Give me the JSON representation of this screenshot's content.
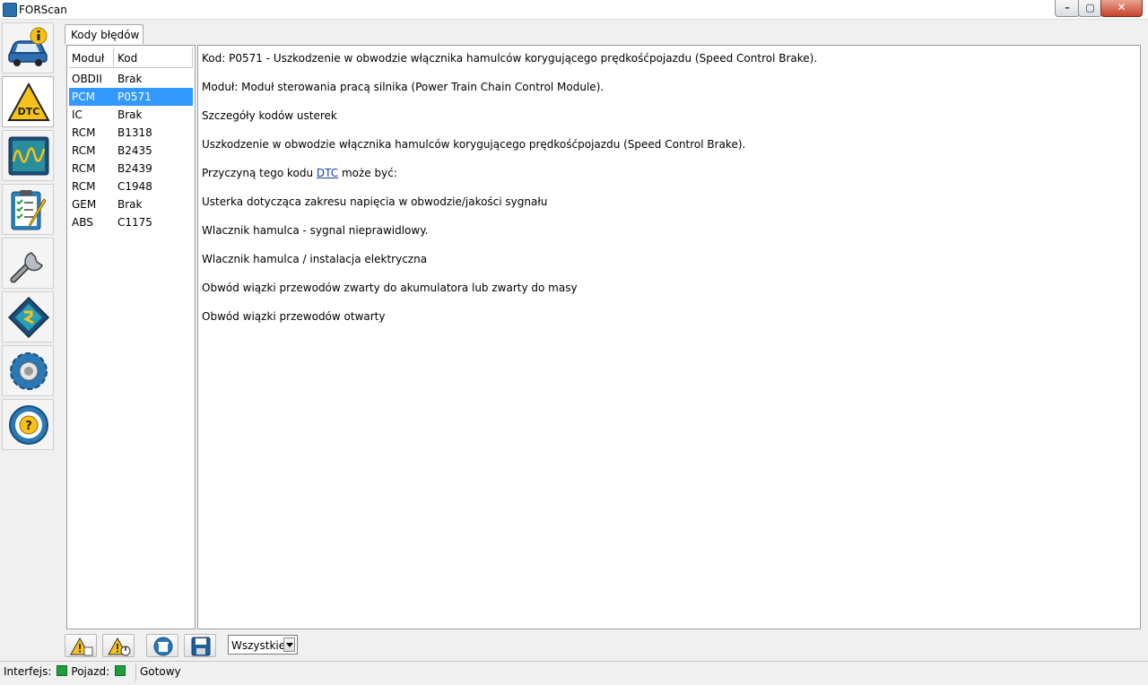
{
  "window": {
    "title": "FORScan",
    "min_glyph": "–",
    "max_glyph": "▢",
    "close_glyph": "✕"
  },
  "sidebar": {
    "items": [
      {
        "icon": "car-info-icon"
      },
      {
        "icon": "dtc-warning-icon",
        "label": "DTC"
      },
      {
        "icon": "oscilloscope-icon"
      },
      {
        "icon": "checklist-icon"
      },
      {
        "icon": "wrench-icon"
      },
      {
        "icon": "chip-icon"
      },
      {
        "icon": "settings-gear-icon"
      },
      {
        "icon": "help-steering-wheel-icon",
        "label": "?"
      }
    ]
  },
  "tab": {
    "label": "Kody błędów"
  },
  "dtc_table": {
    "headers": [
      "Moduł",
      "Kod"
    ],
    "rows": [
      {
        "module": "OBDII",
        "code": "Brak"
      },
      {
        "module": "PCM",
        "code": "P0571"
      },
      {
        "module": "IC",
        "code": "Brak"
      },
      {
        "module": "RCM",
        "code": "B1318"
      },
      {
        "module": "RCM",
        "code": "B2435"
      },
      {
        "module": "RCM",
        "code": "B2439"
      },
      {
        "module": "RCM",
        "code": "C1948"
      },
      {
        "module": "GEM",
        "code": "Brak"
      },
      {
        "module": "ABS",
        "code": "C1175"
      }
    ],
    "selected_index": 1
  },
  "details": {
    "line1": "Kod: P0571 - Uszkodzenie w obwodzie włącznika hamulców korygującego prędkośćpojazdu (Speed Control Brake).",
    "line2": "Moduł: Moduł sterowania pracą silnika (Power Train Chain Control Module).",
    "line3": "Szczegóły kodów usterek",
    "line4": "Uszkodzenie w obwodzie włącznika hamulców korygującego prędkośćpojazdu (Speed Control Brake).",
    "cause_prefix": "Przyczyną tego kodu ",
    "cause_link": "DTC",
    "cause_suffix": " może być:",
    "causes": [
      "Usterka dotycząca zakresu napięcia w obwodzie/jakości sygnału",
      "Wlacznik hamulca - sygnal nieprawidlowy.",
      "Wlacznik hamulca / instalacja elektryczna",
      "Obwód wiązki przewodów zwarty do akumulatora lub zwarty do masy",
      "Obwód wiązki przewodów otwarty"
    ]
  },
  "toolbar": {
    "buttons": [
      "read-dtc-icon",
      "read-dtc-ignition-icon",
      "clear-dtc-icon",
      "save-icon"
    ],
    "filter_value": "Wszystkie"
  },
  "status": {
    "interface_label": "Interfejs:",
    "vehicle_label": "Pojazd:",
    "state_text": "Gotowy",
    "led_color": "#1f9d3a"
  }
}
